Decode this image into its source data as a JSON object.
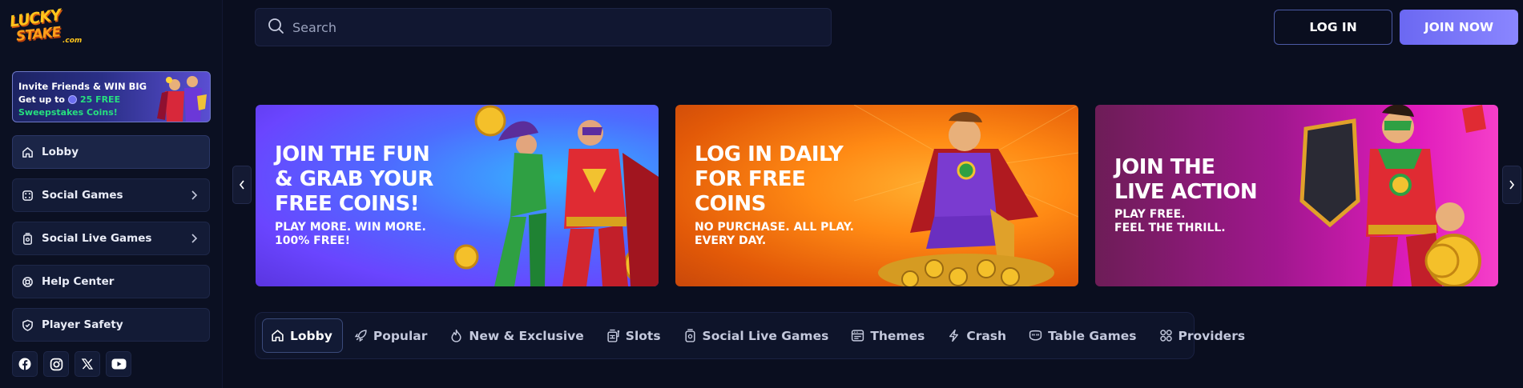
{
  "brand": {
    "logo_line1": "LUCKY",
    "logo_line2": "STAKE",
    "logo_suffix": ".com",
    "accent": "#ffc51c"
  },
  "promo": {
    "line1": "Invite Friends & WIN BIG",
    "line2_prefix": "Get up to",
    "line2_amount": "25 FREE",
    "line3": "Sweepstakes Coins!"
  },
  "sidebar": {
    "items": [
      {
        "label": "Lobby",
        "icon": "home-icon",
        "active": true
      },
      {
        "label": "Social Games",
        "icon": "dice-icon",
        "chevron": true
      },
      {
        "label": "Social Live Games",
        "icon": "live-cards-icon",
        "chevron": true
      },
      {
        "label": "Help Center",
        "icon": "lifebuoy-icon"
      },
      {
        "label": "Player Safety",
        "icon": "shield-check-icon"
      }
    ],
    "socials": [
      "facebook-icon",
      "instagram-icon",
      "x-icon",
      "youtube-icon"
    ]
  },
  "header": {
    "search_placeholder": "Search",
    "login_label": "LOG IN",
    "join_label": "JOIN NOW"
  },
  "banners": [
    {
      "title": "JOIN THE FUN\n& GRAB YOUR\nFREE COINS!",
      "subtitle": "PLAY MORE. WIN MORE.\n100% FREE!"
    },
    {
      "title": "LOG IN DAILY\nFOR FREE\nCOINS",
      "subtitle": "NO PURCHASE. ALL PLAY.\nEVERY DAY."
    },
    {
      "title": "JOIN THE\nLIVE ACTION",
      "subtitle": "PLAY FREE.\nFEEL THE THRILL."
    }
  ],
  "tabs": [
    {
      "label": "Lobby",
      "icon": "home-icon",
      "active": true
    },
    {
      "label": "Popular",
      "icon": "rocket-icon"
    },
    {
      "label": "New & Exclusive",
      "icon": "flame-icon"
    },
    {
      "label": "Slots",
      "icon": "slot-machine-icon"
    },
    {
      "label": "Social Live Games",
      "icon": "live-cards-icon"
    },
    {
      "label": "Themes",
      "icon": "themes-icon"
    },
    {
      "label": "Crash",
      "icon": "lightning-icon"
    },
    {
      "label": "Table Games",
      "icon": "table-icon"
    },
    {
      "label": "Providers",
      "icon": "grid-icon"
    }
  ]
}
